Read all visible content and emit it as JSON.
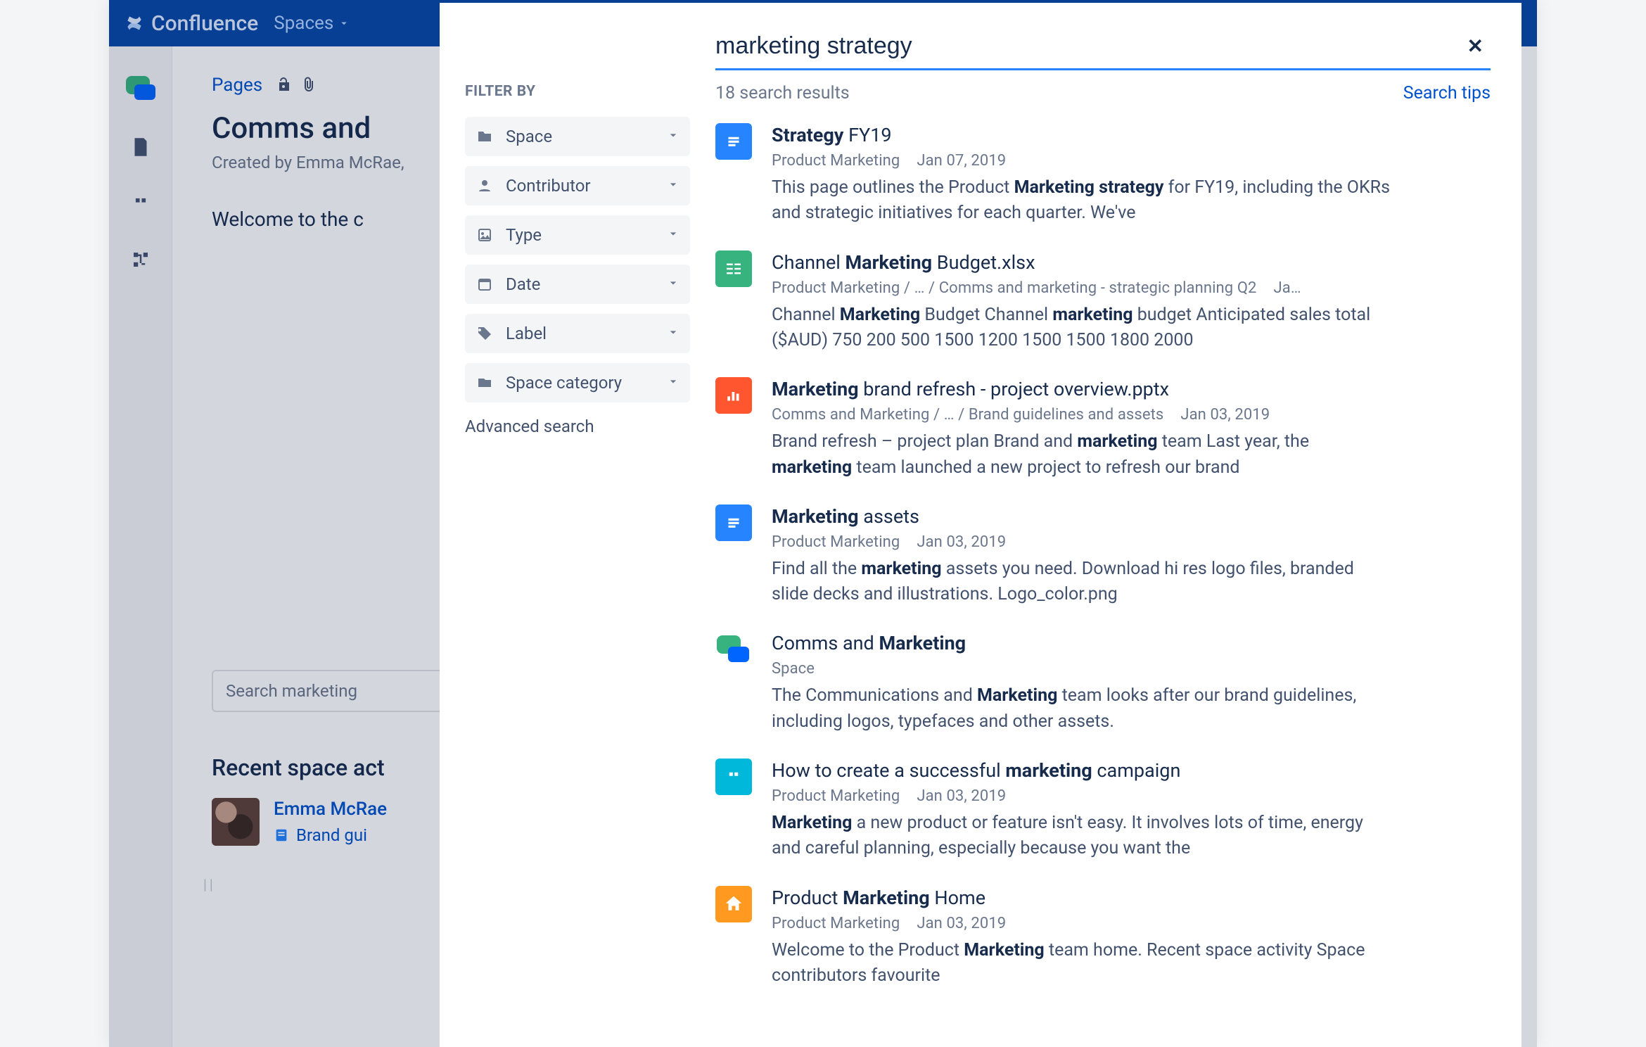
{
  "brand_name": "Confluence",
  "topnav": {
    "spaces": "Spaces"
  },
  "underpage": {
    "crumb_pages": "Pages",
    "title_visible": "Comms and",
    "created_by_visible": "Created by Emma McRae,",
    "welcome_visible": "Welcome to the c",
    "search_placeholder": "Search marketing",
    "recent_heading_visible": "Recent space act",
    "recent_user": "Emma McRae",
    "recent_item_visible": "Brand gui"
  },
  "overlay": {
    "filter_heading": "FILTER BY",
    "filters": [
      {
        "icon": "folder",
        "label": "Space"
      },
      {
        "icon": "person",
        "label": "Contributor"
      },
      {
        "icon": "type",
        "label": "Type"
      },
      {
        "icon": "date",
        "label": "Date"
      },
      {
        "icon": "tag",
        "label": "Label"
      },
      {
        "icon": "cat",
        "label": "Space category"
      }
    ],
    "advanced": "Advanced search",
    "query": "marketing strategy",
    "result_count_text": "18 search results",
    "tips": "Search tips",
    "results": [
      {
        "icon": "page",
        "title_html": "<b>Strategy</b> FY19",
        "meta": "Product Marketing   Jan 07, 2019",
        "desc_html": "This page outlines the Product <b>Marketing strategy</b> for FY19, including the OKRs and strategic initiatives for each quarter. We've"
      },
      {
        "icon": "sheet",
        "title_html": "Channel <b>Marketing</b> Budget.xlsx",
        "meta": "Product Marketing / … / Comms and marketing - strategic planning Q2   Ja…",
        "desc_html": "Channel <b>Marketing</b> Budget Channel <b>marketing</b> budget Anticipated sales total ($AUD) 750 200 500 1500 1200 1500 1500 1800 2000"
      },
      {
        "icon": "pres",
        "title_html": "<b>Marketing</b> brand refresh - project overview.pptx",
        "meta": "Comms and Marketing / … / Brand guidelines and assets   Jan 03, 2019",
        "desc_html": "Brand refresh – project plan Brand and <b>marketing</b> team Last year, the <b>marketing</b> team launched a new project to refresh our brand"
      },
      {
        "icon": "page",
        "title_html": "<b>Marketing</b> assets",
        "meta": "Product Marketing   Jan 03, 2019",
        "desc_html": "Find all the <b>marketing</b> assets you need. Download hi res logo files, branded slide decks and illustrations. Logo_color.png"
      },
      {
        "icon": "space",
        "title_html": "Comms and <b>Marketing</b>",
        "meta": "Space",
        "desc_html": "The Communications and <b>Marketing</b> team looks after our brand guidelines, including logos, typefaces and other assets."
      },
      {
        "icon": "quote",
        "title_html": "How to create a successful <b>marketing</b> campaign",
        "meta": "Product Marketing   Jan 03, 2019",
        "desc_html": "<b>Marketing</b> a new product or feature isn't easy. It involves lots of time, energy and careful planning, especially because you want the"
      },
      {
        "icon": "home",
        "title_html": "Product <b>Marketing</b> Home",
        "meta": "Product Marketing   Jan 03, 2019",
        "desc_html": "Welcome to the Product <b>Marketing</b> team home. Recent space activity Space contributors favourite"
      }
    ]
  }
}
